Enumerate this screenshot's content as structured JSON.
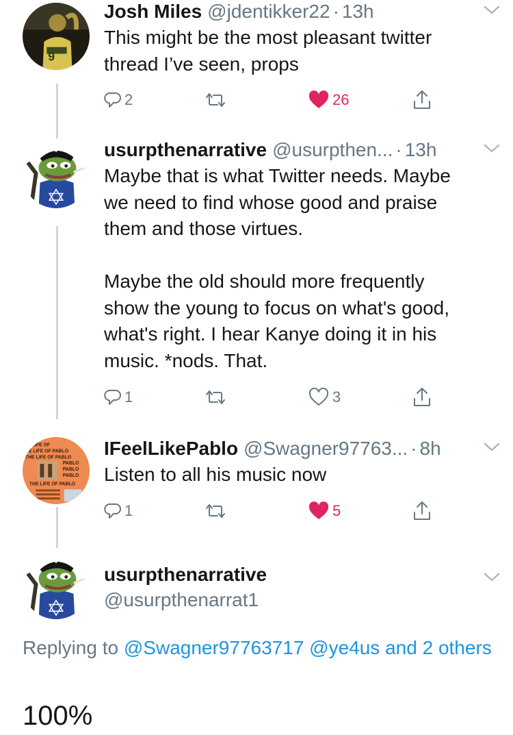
{
  "tweets": [
    {
      "name": "Josh Miles",
      "handle": "@jdentikker22",
      "time": "13h",
      "text": "This might be the most pleasant twitter\nthread I’ve seen, props",
      "replies": "2",
      "likes": "26",
      "liked": true,
      "avatar_icon": "masked-person-avatar"
    },
    {
      "name": "usurpthenarrative",
      "handle": "@usurpthen...",
      "time": "13h",
      "text": "Maybe that is what Twitter needs. Maybe\nwe need to find whose good and praise\nthem and those virtues.\n\nMaybe the old should more frequently\nshow the young to focus on what's good,\nwhat's right. I hear Kanye doing it in his\nmusic. *nods. That.",
      "replies": "1",
      "likes": "3",
      "liked": false,
      "avatar_icon": "frog-avatar"
    },
    {
      "name": "IFeelLikePablo",
      "handle": "@Swagner97763...",
      "time": "8h",
      "text": "Listen to all his music now",
      "replies": "1",
      "likes": "5",
      "liked": true,
      "avatar_icon": "album-cover-avatar"
    }
  ],
  "avatar_text": {
    "pablo": [
      "LIFE OF",
      "HE LIFE OF  PABLO",
      "THE LIFE OF  PABLO",
      "PABLO",
      "PABLO",
      "PABLO",
      "THE LIFE OF   PABLO"
    ]
  },
  "main_tweet": {
    "name": "usurpthenarrative",
    "handle": "@usurpthenarrat1",
    "replying_prefix": "Replying to",
    "reply_mentions": "@Swagner97763717 @ye4us",
    "reply_others": "and 2 others",
    "text": "100%"
  },
  "colors": {
    "text": "#14171a",
    "secondary": "#657786",
    "like": "#e0245e",
    "link": "#1b95e0",
    "thread_line": "#ccd6dd"
  }
}
